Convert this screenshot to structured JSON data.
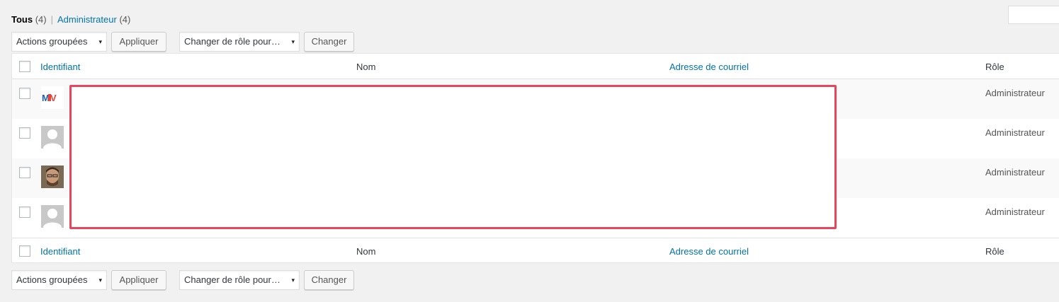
{
  "filters": {
    "all_label": "Tous",
    "all_count": "(4)",
    "separator": "|",
    "admin_label": "Administrateur",
    "admin_count": "(4)"
  },
  "toolbar_top": {
    "bulk_select": "Actions groupées",
    "apply_button": "Appliquer",
    "role_select": "Changer de rôle pour…",
    "change_button": "Changer"
  },
  "toolbar_bottom": {
    "bulk_select": "Actions groupées",
    "apply_button": "Appliquer",
    "role_select": "Changer de rôle pour…",
    "change_button": "Changer"
  },
  "table": {
    "columns": [
      "Identifiant",
      "Nom",
      "Adresse de courriel",
      "Rôle"
    ],
    "rows": [
      {
        "avatar": "logo-avatar",
        "role": "Administrateur"
      },
      {
        "avatar": "default-avatar",
        "role": "Administrateur"
      },
      {
        "avatar": "photo-avatar",
        "role": "Administrateur"
      },
      {
        "avatar": "default-avatar",
        "role": "Administrateur"
      }
    ]
  },
  "colors": {
    "link": "#0073aa",
    "redaction_border": "#e8445e",
    "page_background": "#f1f1f1"
  },
  "icons": {
    "dropdown": "▾"
  }
}
